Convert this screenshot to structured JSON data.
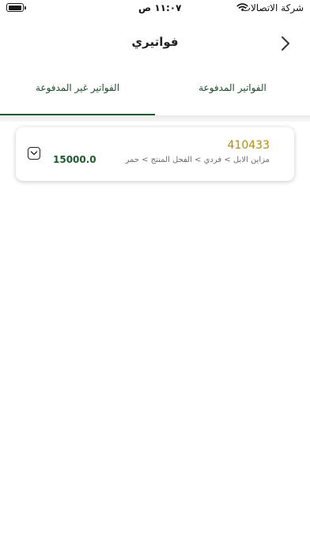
{
  "status_bar": {
    "time": "١١:٠٧ ص",
    "carrier": "شركة الاتصالات",
    "battery_level": 1.0
  },
  "nav": {
    "title": "فواتيري"
  },
  "tabs": [
    {
      "label": "الفواتير غير المدفوعة",
      "selected": true
    },
    {
      "label": "الفواتير المدفوعة",
      "selected": false
    }
  ],
  "invoices": [
    {
      "number": "410433",
      "path": "مزاين الابل > فردي > الفحل المنتج > حمر",
      "amount": "15000.0"
    }
  ],
  "colors": {
    "accent_green": "#1c5a2e",
    "invoice_number_gold": "#b48a10"
  },
  "icons": {
    "back": "chevron-right-icon",
    "wifi": "wifi-icon",
    "battery": "battery-icon",
    "expand": "chevron-down-icon"
  }
}
